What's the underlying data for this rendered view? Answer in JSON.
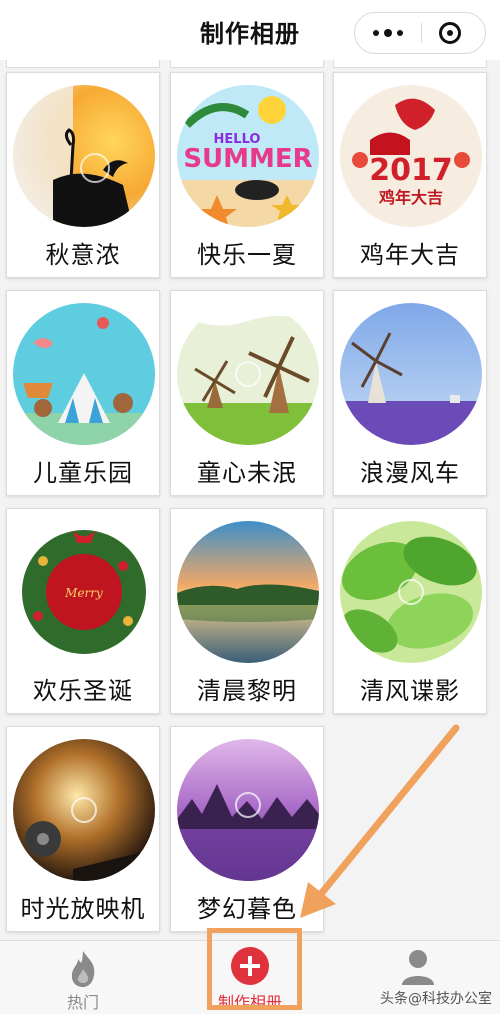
{
  "header": {
    "title": "制作相册",
    "more_icon": "more-dots-icon",
    "close_icon": "target-icon"
  },
  "albums": [
    {
      "label": "秋意浓",
      "icon": "autumn-cranes-thumbnail"
    },
    {
      "label": "快乐一夏",
      "icon": "hello-summer-thumbnail"
    },
    {
      "label": "鸡年大吉",
      "icon": "rooster-2017-thumbnail"
    },
    {
      "label": "儿童乐园",
      "icon": "kids-park-thumbnail"
    },
    {
      "label": "童心未泯",
      "icon": "windmills-meadow-thumbnail"
    },
    {
      "label": "浪漫风车",
      "icon": "windmill-lavender-thumbnail"
    },
    {
      "label": "欢乐圣诞",
      "icon": "christmas-wreath-thumbnail"
    },
    {
      "label": "清晨黎明",
      "icon": "dawn-lake-thumbnail"
    },
    {
      "label": "清风谍影",
      "icon": "green-leaves-thumbnail"
    },
    {
      "label": "时光放映机",
      "icon": "film-projector-thumbnail"
    },
    {
      "label": "梦幻暮色",
      "icon": "purple-dusk-thumbnail"
    }
  ],
  "tabs": [
    {
      "label": "热门",
      "icon": "flame-icon",
      "active": false
    },
    {
      "label": "制作相册",
      "icon": "plus-circle-icon",
      "active": true
    },
    {
      "label": "",
      "icon": "person-icon",
      "active": false
    }
  ],
  "watermark": "头条@科技办公室",
  "colors": {
    "accent": "#e0323c",
    "annotation": "#f0a15c"
  }
}
